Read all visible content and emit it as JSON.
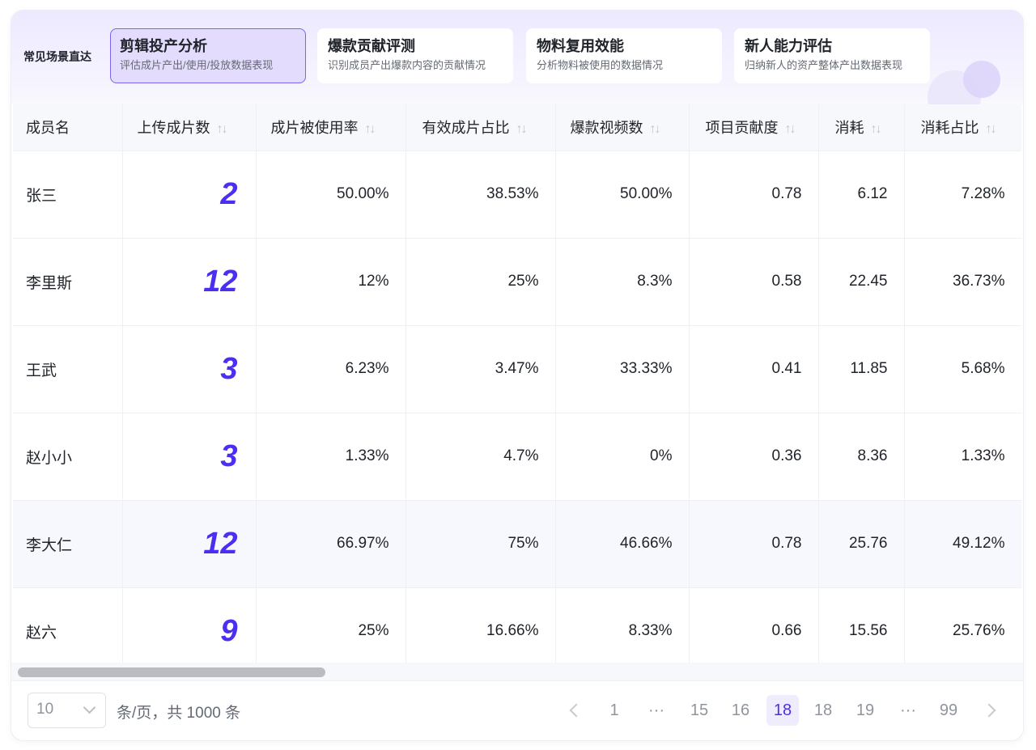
{
  "scenes": {
    "label": "常见场景直达",
    "cards": [
      {
        "title": "剪辑投产分析",
        "subtitle": "评估成片产出/使用/投放数据表现"
      },
      {
        "title": "爆款贡献评测",
        "subtitle": "识别成员产出爆款内容的贡献情况"
      },
      {
        "title": "物料复用效能",
        "subtitle": "分析物料被使用的数据情况"
      },
      {
        "title": "新人能力评估",
        "subtitle": "归纳新人的资产整体产出数据表现"
      }
    ]
  },
  "table": {
    "columns": [
      "成员名",
      "上传成片数",
      "成片被使用率",
      "有效成片占比",
      "爆款视频数",
      "项目贡献度",
      "消耗",
      "消耗占比"
    ],
    "sort_icon": "sort-icon",
    "rows": [
      [
        "张三",
        "2",
        "50.00%",
        "38.53%",
        "50.00%",
        "0.78",
        "6.12",
        "7.28%"
      ],
      [
        "李里斯",
        "12",
        "12%",
        "25%",
        "8.3%",
        "0.58",
        "22.45",
        "36.73%"
      ],
      [
        "王武",
        "3",
        "6.23%",
        "3.47%",
        "33.33%",
        "0.41",
        "11.85",
        "5.68%"
      ],
      [
        "赵小小",
        "3",
        "1.33%",
        "4.7%",
        "0%",
        "0.36",
        "8.36",
        "1.33%"
      ],
      [
        "李大仁",
        "12",
        "66.97%",
        "75%",
        "46.66%",
        "0.78",
        "25.76",
        "49.12%"
      ],
      [
        "赵六",
        "9",
        "25%",
        "16.66%",
        "8.33%",
        "0.66",
        "15.56",
        "25.76%"
      ]
    ]
  },
  "pagination": {
    "page_size": "10",
    "total_text": "条/页，共 1000 条",
    "pages": [
      "1",
      "···",
      "15",
      "16",
      "18",
      "18",
      "19",
      "···",
      "99"
    ],
    "current_index": 4
  },
  "colors": {
    "accent": "#4a2ff0",
    "active_card_bg": "#e3dcfd",
    "active_card_border": "#7c63f0"
  }
}
